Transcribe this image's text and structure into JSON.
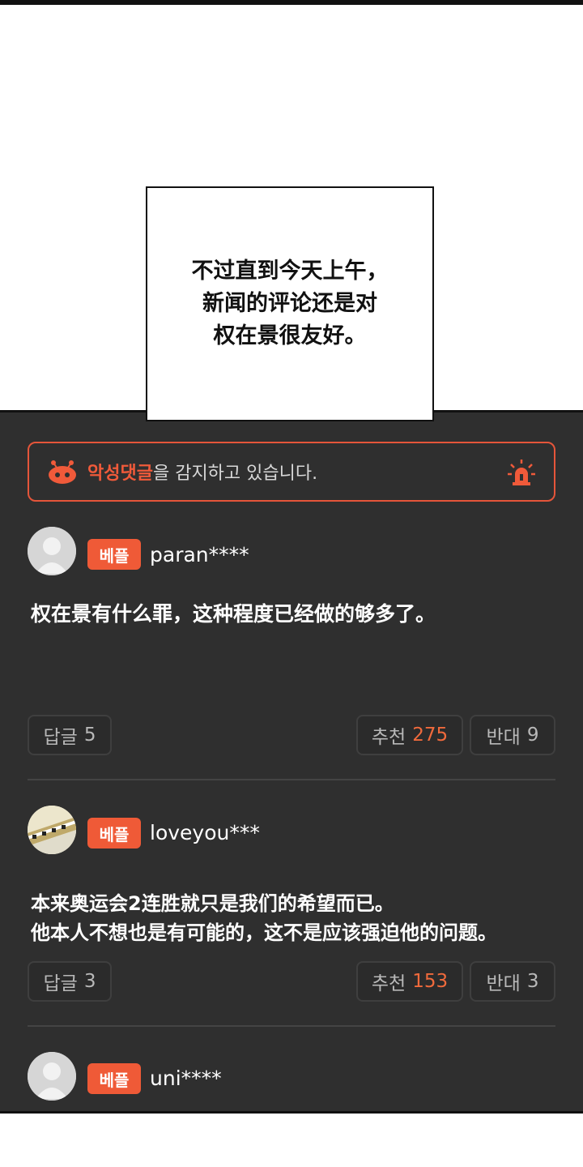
{
  "caption": {
    "text": "不过直到今天上午，\n新闻的评论还是对\n权在景很友好。"
  },
  "alert": {
    "highlight": "악성댓글",
    "rest": "을 감지하고 있습니다."
  },
  "comments": [
    {
      "badge": "베플",
      "username": "paran****",
      "body": "权在景有什么罪，这种程度已经做的够多了。",
      "reply_label": "답글",
      "reply_count": "5",
      "like_label": "추천",
      "like_count": "275",
      "dislike_label": "반대",
      "dislike_count": "9"
    },
    {
      "badge": "베플",
      "username": "loveyou***",
      "body": "本来奥运会2连胜就只是我们的希望而已。\n他本人不想也是有可能的，这不是应该强迫他的问题。",
      "reply_label": "답글",
      "reply_count": "3",
      "like_label": "추천",
      "like_count": "153",
      "dislike_label": "반대",
      "dislike_count": "3"
    },
    {
      "badge": "베플",
      "username": "uni****"
    }
  ],
  "colors": {
    "accent": "#ef5a37",
    "panel": "#2f2f2f"
  }
}
